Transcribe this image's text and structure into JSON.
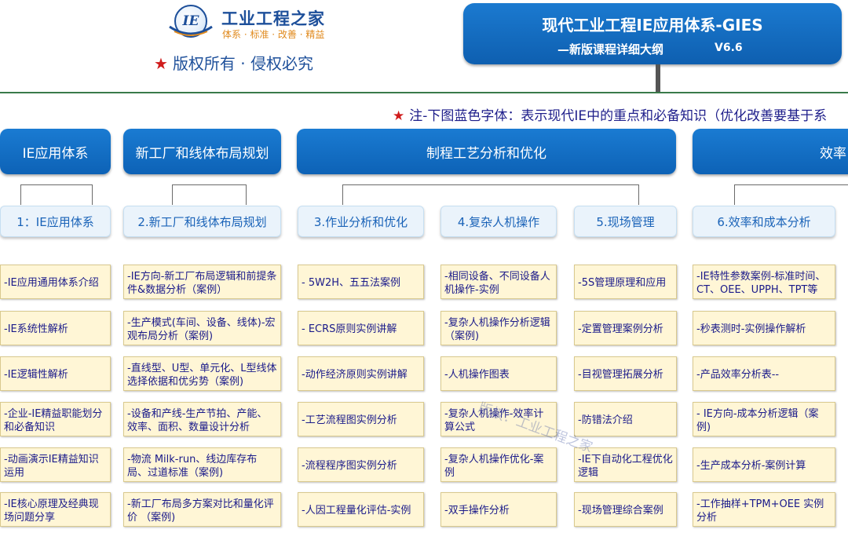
{
  "logo": {
    "mark": "IE",
    "name": "工业工程之家",
    "slogan": "体系 · 标准 · 改善 · 精益"
  },
  "copyright": {
    "star": "★",
    "text": "版权所有 · 侵权必究"
  },
  "title": {
    "main": "现代工业工程IE应用体系-GIES",
    "sub": "—新版课程详细大纲",
    "version": "V6.6"
  },
  "note": {
    "star": "★",
    "text": "注-下图蓝色字体：表示现代IE中的重点和必备知识（优化改善要基于系"
  },
  "categories": [
    "IE应用体系",
    "新工厂和线体布局规划",
    "制程工艺分析和优化",
    "效率"
  ],
  "modules": [
    "1：IE应用体系",
    "2.新工厂和线体布局规划",
    "3.作业分析和优化",
    "4.复杂人机操作",
    "5.现场管理",
    "6.效率和成本分析"
  ],
  "columns": [
    [
      "-IE应用通用体系介绍",
      "-IE系统性解析",
      "-IE逻辑性解析",
      "-企业-IE精益职能划分和必备知识",
      "-动画演示IE精益知识运用",
      "-IE核心原理及经典现场问题分享"
    ],
    [
      "-IE方向-新工厂布局逻辑和前提条件&数据分析（案例）",
      "-生产模式(车间、设备、线体)-宏观布局分析（案例)",
      "-直线型、U型、单元化、L型线体选择依据和优劣势（案例)",
      "-设备和产线-生产节拍、产能、效率、面积、数量设计分析",
      "-物流 Milk-run、线边库存布局、过道标准（案例)",
      "-新工厂布局多方案对比和量化评价 （案例)"
    ],
    [
      "- 5W2H、五五法案例",
      "- ECRS原则实例讲解",
      "-动作经济原则实例讲解",
      "-工艺流程图实例分析",
      "-流程程序图实例分析",
      "-人因工程量化评估-实例"
    ],
    [
      "-相同设备、不同设备人机操作-实例",
      "-复杂人机操作分析逻辑（案例)",
      "-人机操作图表",
      "-复杂人机操作-效率计算公式",
      "-复杂人机操作优化-案例",
      "-双手操作分析"
    ],
    [
      "-5S管理原理和应用",
      "-定置管理案例分析",
      "-目视管理拓展分析",
      "-防错法介绍",
      "-IE下自动化工程优化逻辑",
      "-现场管理综合案例"
    ],
    [
      "-IE特性参数案例-标准时间、CT、OEE、UPPH、TPT等",
      "-秒表测时-实例操作解析",
      "-产品效率分析表--",
      "- IE方向-成本分析逻辑（案例)",
      "-生产成本分析-案例计算",
      "-工作抽样+TPM+OEE 实例分析"
    ]
  ],
  "watermark": "版权：工业工程之家"
}
